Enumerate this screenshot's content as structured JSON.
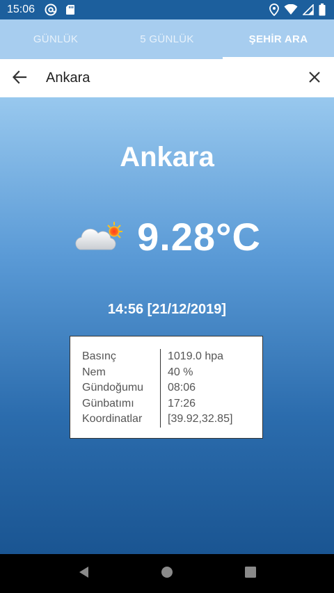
{
  "status_bar": {
    "time": "15:06",
    "icons": [
      "at-sign-icon",
      "sd-card-icon",
      "location-icon",
      "wifi-icon",
      "signal-icon",
      "battery-icon"
    ]
  },
  "tabs": [
    {
      "label": "GÜNLÜK",
      "active": false
    },
    {
      "label": "5 GÜNLÜK",
      "active": false
    },
    {
      "label": "ŞEHİR ARA",
      "active": true
    }
  ],
  "search": {
    "value": "Ankara",
    "back_icon": "arrow-left-icon",
    "clear_icon": "close-icon"
  },
  "weather": {
    "city": "Ankara",
    "icon": "partly-cloudy-sun-icon",
    "temperature": "9.28°C",
    "datetime": "14:56 [21/12/2019]",
    "details": [
      {
        "label": "Basınç",
        "value": "1019.0 hpa"
      },
      {
        "label": "Nem",
        "value": "40 %"
      },
      {
        "label": "Gündoğumu",
        "value": "08:06"
      },
      {
        "label": "Günbatımı",
        "value": "17:26"
      },
      {
        "label": "Koordinatlar",
        "value": "[39.92,32.85]"
      }
    ]
  },
  "nav_bar": {
    "buttons": [
      "back-triangle-icon",
      "home-circle-icon",
      "recents-square-icon"
    ]
  },
  "colors": {
    "status_bar": "#1c5f9d",
    "tab_bar": "#a7cdef",
    "gradient_top": "#98c8ee",
    "gradient_bottom": "#1a5592"
  }
}
